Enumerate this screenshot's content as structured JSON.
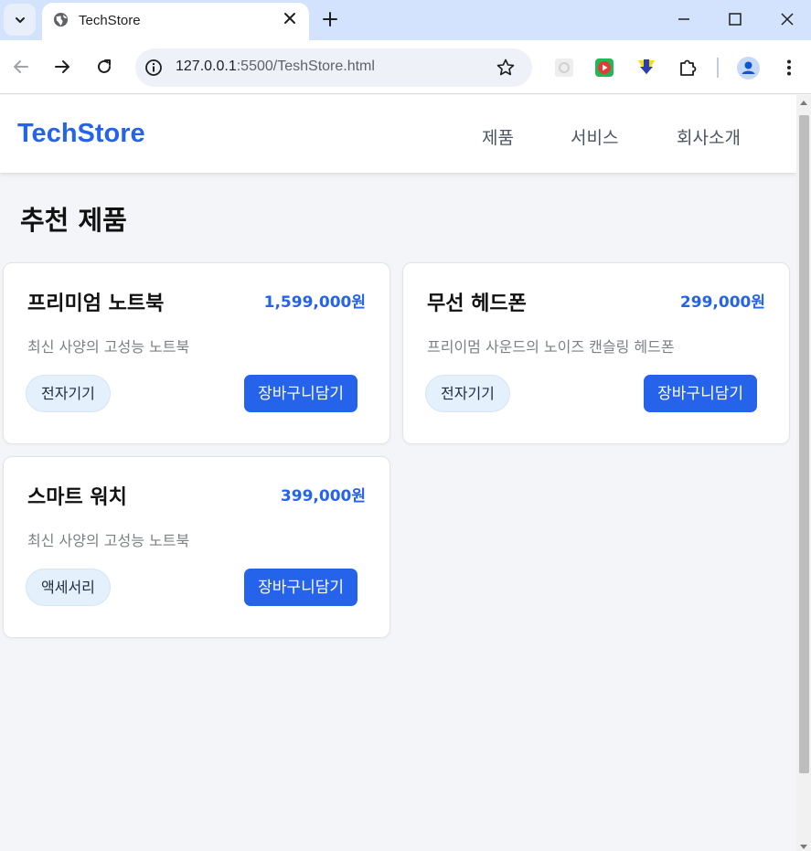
{
  "browser": {
    "tab_title": "TechStore",
    "url_host": "127.0.0.1",
    "url_rest": ":5500/TeshStore.html"
  },
  "site": {
    "logo": "TechStore",
    "nav": [
      "제품",
      "서비스",
      "회사소개"
    ],
    "section_title": "추천 제품"
  },
  "products": [
    {
      "name": "프리미엄 노트북",
      "price": "1,599,000원",
      "desc": "최신 사양의 고성능 노트북",
      "tag": "전자기기",
      "button": "장바구니담기"
    },
    {
      "name": "무선 헤드폰",
      "price": "299,000원",
      "desc": "프리이멈 사운드의 노이즈 캔슬링 헤드폰",
      "tag": "전자기기",
      "button": "장바구니담기"
    },
    {
      "name": "스마트 워치",
      "price": "399,000원",
      "desc": "최신 사양의 고성능 노트북",
      "tag": "액세서리",
      "button": "장바구니담기"
    }
  ],
  "colors": {
    "accent": "#2563eb",
    "tag_bg": "#e4f0fb",
    "page_bg": "#f4f5f8"
  }
}
